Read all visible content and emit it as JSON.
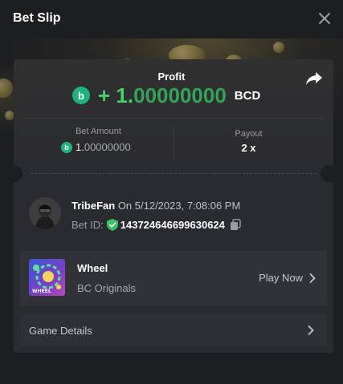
{
  "header": {
    "title": "Bet Slip"
  },
  "profit": {
    "label": "Profit",
    "sign": "+",
    "amount_bright": "1.",
    "amount_rest": "00000000",
    "currency": "BCD"
  },
  "stats": {
    "bet_amount_label": "Bet Amount",
    "bet_amount_bright": "1.",
    "bet_amount_rest": "00000000",
    "payout_label": "Payout",
    "payout_value": "2 x"
  },
  "bet": {
    "username": "TribeFan",
    "when": "On 5/12/2023, 7:08:06 PM",
    "bet_id_label": "Bet ID:",
    "bet_id": "143724646699630624"
  },
  "game": {
    "name": "Wheel",
    "provider": "BC Originals",
    "thumb_text": "WHEEL",
    "play_label": "Play Now"
  },
  "details": {
    "label": "Game Details"
  },
  "colors": {
    "accent_green": "#44d06f",
    "bc_icon": "#1fb17e",
    "background": "#1d1e22",
    "card": "#2a2b30"
  },
  "icons": {
    "close": "close-icon",
    "share": "share-icon",
    "coin": "bc-coin-icon",
    "shield": "shield-check-icon",
    "copy": "copy-icon",
    "chevron": "chevron-right-icon"
  }
}
